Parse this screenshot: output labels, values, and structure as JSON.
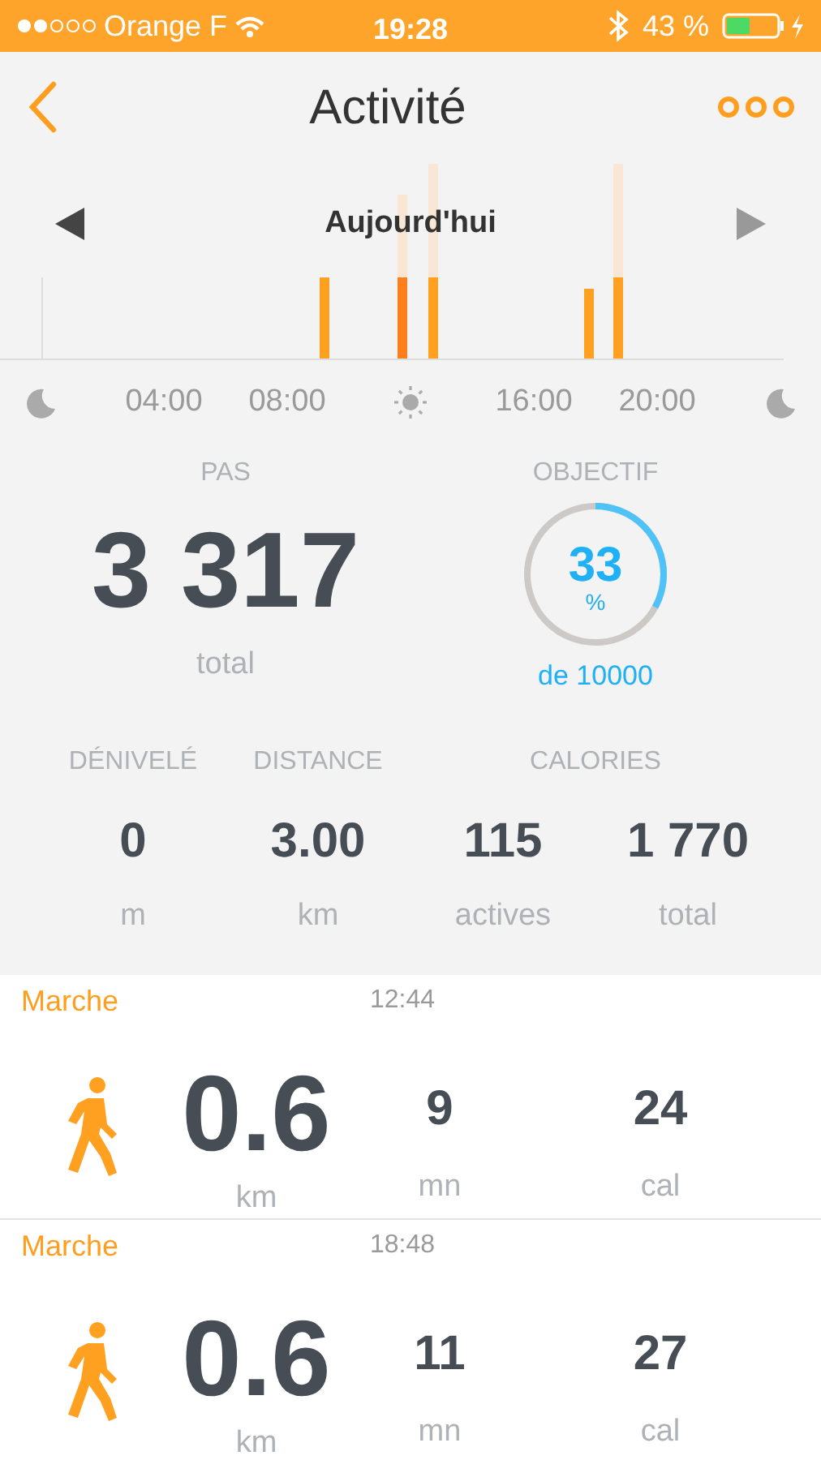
{
  "status_bar": {
    "carrier": "Orange F",
    "time": "19:28",
    "battery": "43 %"
  },
  "header": {
    "title": "Activité"
  },
  "chart": {
    "period": "Aujourd'hui",
    "axis_labels": [
      {
        "kind": "moon"
      },
      {
        "kind": "text",
        "text": "04:00"
      },
      {
        "kind": "text",
        "text": "08:00"
      },
      {
        "kind": "sun"
      },
      {
        "kind": "text",
        "text": "16:00"
      },
      {
        "kind": "text",
        "text": "20:00"
      },
      {
        "kind": "moon"
      }
    ]
  },
  "steps": {
    "heading": "PAS",
    "value": "3 317",
    "unit": "total"
  },
  "goal": {
    "heading": "OBJECTIF",
    "percent": "33",
    "percent_sign": "%",
    "level": 0.33,
    "target": "de 10000"
  },
  "metrics": [
    {
      "heading": "DÉNIVELÉ",
      "values": [
        {
          "value": "0",
          "unit": "m"
        }
      ]
    },
    {
      "heading": "DISTANCE",
      "values": [
        {
          "value": "3.00",
          "unit": "km"
        }
      ]
    },
    {
      "heading": "CALORIES",
      "values": [
        {
          "value": "115",
          "unit": "actives"
        },
        {
          "value": "1 770",
          "unit": "total"
        }
      ]
    }
  ],
  "activities": [
    {
      "type": "Marche",
      "time": "12:44",
      "distance": "0.6",
      "distance_unit": "km",
      "duration": "9",
      "duration_unit": "mn",
      "calories": "24",
      "calories_unit": "cal"
    },
    {
      "type": "Marche",
      "time": "18:48",
      "distance": "0.6",
      "distance_unit": "km",
      "duration": "11",
      "duration_unit": "mn",
      "calories": "27",
      "calories_unit": "cal"
    }
  ]
}
